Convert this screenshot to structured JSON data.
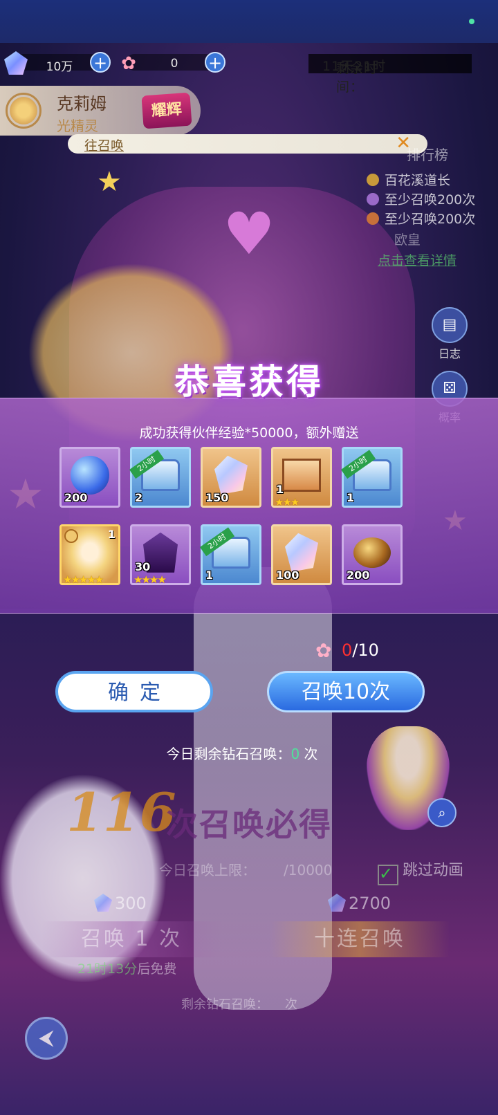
{
  "resources": {
    "diamond_amount": "10万",
    "tulip_amount": "0"
  },
  "event": {
    "remaining_time_label": "剩余时间：",
    "remaining_time_value": "11天21时"
  },
  "character": {
    "name": "克莉姆",
    "class": "光精灵",
    "badge": "耀辉"
  },
  "banner": {
    "link_text": "往召唤"
  },
  "ranking": {
    "title": "排行榜",
    "rows": [
      "百花溪道长",
      "至少召唤200次",
      "至少召唤200次",
      "欧皇"
    ],
    "details_link": "点击查看详情"
  },
  "side_buttons": {
    "log_label": "日志",
    "prob_label": "概率"
  },
  "reward_popup": {
    "title": "恭喜获得",
    "subtitle": "成功获得伙伴经验*50000，额外赠送",
    "timed_ribbon": "2小时",
    "items_row1": [
      {
        "icon": "crystal-orb-icon",
        "qty": "200",
        "stars": ""
      },
      {
        "icon": "timed-chest-icon",
        "qty": "2",
        "stars": ""
      },
      {
        "icon": "diamond-icon",
        "qty": "150",
        "stars": ""
      },
      {
        "icon": "mystery-box-icon",
        "qty": "1",
        "stars": "★★★"
      },
      {
        "icon": "timed-chest-icon",
        "qty": "1",
        "stars": ""
      }
    ],
    "items_row2": [
      {
        "icon": "elf-portrait-icon",
        "qty": "1",
        "stars": "★★★★★"
      },
      {
        "icon": "dark-shard-icon",
        "qty": "30",
        "stars": "★★★★"
      },
      {
        "icon": "timed-chest-icon",
        "qty": "1",
        "stars": ""
      },
      {
        "icon": "diamond-icon",
        "qty": "100",
        "stars": ""
      },
      {
        "icon": "amber-stone-icon",
        "qty": "200",
        "stars": ""
      }
    ]
  },
  "tulip_counter": {
    "current": "0",
    "max": "/10"
  },
  "buttons": {
    "confirm": "确定",
    "summon10": "召唤10次"
  },
  "today": {
    "label": "今日剩余钻石召唤：",
    "value": "0",
    "unit": "次"
  },
  "guarantee": {
    "number": "116",
    "text": "次召唤必得"
  },
  "limit": {
    "label": "今日召唤上限：",
    "value": "/10000"
  },
  "skip": {
    "label": "跳过动画",
    "checked": true
  },
  "costs": {
    "single_cost": "300",
    "ten_cost": "2700"
  },
  "summon_buttons": {
    "single": "召唤 1 次",
    "ten": "十连召唤"
  },
  "free": {
    "time": "21时13分",
    "suffix": "后免费"
  },
  "remaining_diamond": {
    "label": "剩余钻石召唤：",
    "unit": "次"
  },
  "colors": {
    "accent_blue": "#2a6ae0",
    "highlight_green": "#4fe39a",
    "warning_red": "#ff3030"
  }
}
